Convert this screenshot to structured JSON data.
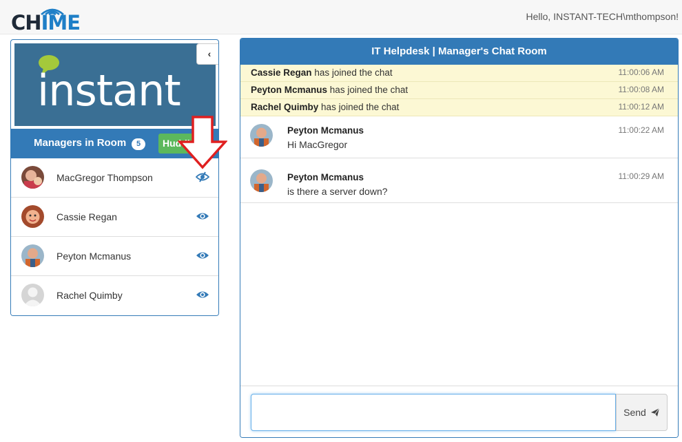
{
  "app": {
    "logo_text_pre": "CH",
    "logo_text_hl": "IME",
    "greeting": "Hello, INSTANT-TECH\\mthompson!"
  },
  "brand": {
    "name": "instant",
    "collapse_glyph": "‹"
  },
  "managers": {
    "title": "Managers in Room",
    "count": "5",
    "huddle_label": "Huddle",
    "list": [
      {
        "name": "MacGregor Thompson",
        "avatar_color": "#b5523f",
        "hidden": true
      },
      {
        "name": "Cassie Regan",
        "avatar_color": "#c8613c",
        "hidden": false
      },
      {
        "name": "Peyton Mcmanus",
        "avatar_color": "#a8583a",
        "hidden": false
      },
      {
        "name": "Rachel Quimby",
        "avatar_color": "#c7c7c7",
        "hidden": false
      }
    ]
  },
  "chat": {
    "title": "IT Helpdesk | Manager's Chat Room",
    "system_events": [
      {
        "user": "Cassie Regan",
        "text": "has joined the chat",
        "time": "11:00:06 AM"
      },
      {
        "user": "Peyton Mcmanus",
        "text": "has joined the chat",
        "time": "11:00:08 AM"
      },
      {
        "user": "Rachel Quimby",
        "text": "has joined the chat",
        "time": "11:00:12 AM"
      }
    ],
    "messages": [
      {
        "author": "Peyton Mcmanus",
        "text": "Hi MacGregor",
        "time": "11:00:22 AM"
      },
      {
        "author": "Peyton Mcmanus",
        "text": "is there a server down?",
        "time": "11:00:29 AM"
      }
    ],
    "input_value": "",
    "send_label": "Send"
  },
  "colors": {
    "primary": "#337ab7",
    "success": "#5cb85c",
    "system_row": "#fcf8d4",
    "annotation": "#e02020"
  },
  "icons": {
    "eye": "eye-icon",
    "eye_slash": "eye-slash-icon",
    "send": "paper-plane-icon",
    "collapse": "chevron-left-icon"
  }
}
